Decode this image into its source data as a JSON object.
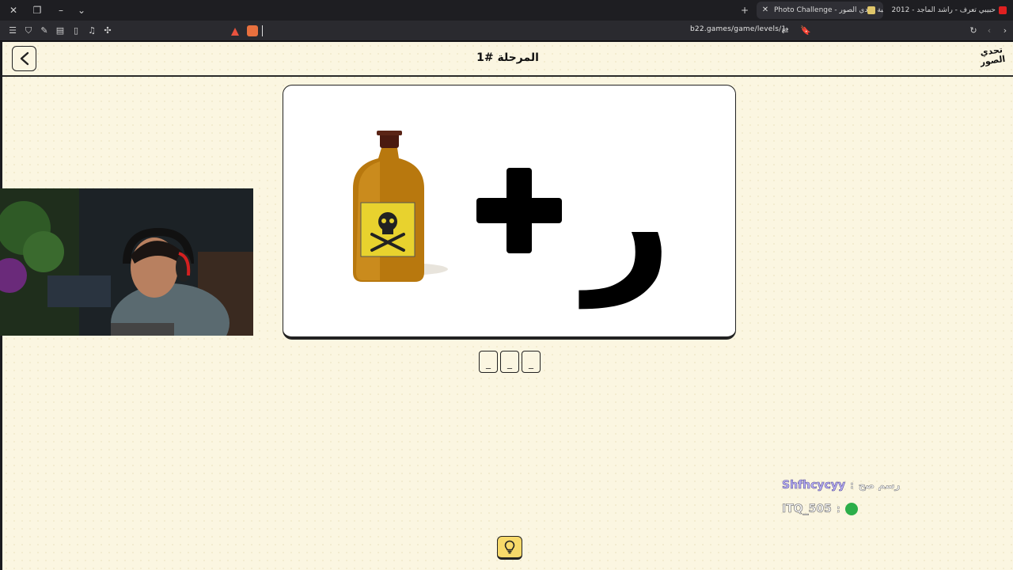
{
  "browser": {
    "tabs": [
      {
        "title": "Photo Challenge - لعبة تحدي الصور",
        "active": true
      },
      {
        "title": "حبيبي تعرف - راشد الماجد - 2012 - YouTube",
        "active": false
      }
    ],
    "url": "b22.games/game/levels/1",
    "new_tab_label": "+"
  },
  "game": {
    "level_title": "المرحلة #1",
    "logo_text": "تحدي الصور",
    "puzzle": {
      "items": [
        "poison-bottle",
        "plus",
        "ر"
      ],
      "letter": "ر",
      "plus": "+"
    },
    "answer_slots": [
      "_",
      "_",
      "_"
    ]
  },
  "chat": [
    {
      "user": "Shfhcycyy",
      "message": "رسم صح",
      "separator": ":"
    },
    {
      "user": "ITQ_505",
      "message": "",
      "separator": ":",
      "emote": "green-emote"
    }
  ],
  "colors": {
    "page_bg": "#fbf6e1",
    "hint_bg": "#f7d96a",
    "border": "#222222"
  }
}
